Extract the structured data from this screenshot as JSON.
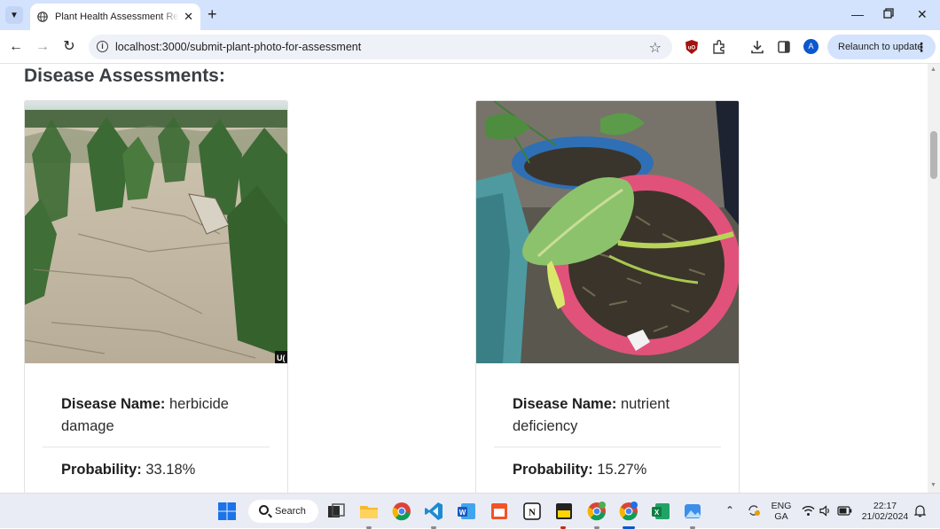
{
  "browser": {
    "tab_title": "Plant Health Assessment Results",
    "url": "localhost:3000/submit-plant-photo-for-assessment",
    "relaunch_label": "Relaunch to update",
    "profile_initial": "A"
  },
  "page": {
    "heading": "Disease Assessments:",
    "assessments": [
      {
        "name_label": "Disease Name:",
        "name_value": "herbicide damage",
        "prob_label": "Probability:",
        "prob_value": "33.18%",
        "image_badge": "U("
      },
      {
        "name_label": "Disease Name:",
        "name_value": "nutrient deficiency",
        "prob_label": "Probability:",
        "prob_value": "15.27%"
      }
    ]
  },
  "taskbar": {
    "search_label": "Search",
    "lang_primary": "ENG",
    "lang_secondary": "GA",
    "time": "22:17",
    "date": "21/02/2024"
  },
  "colors": {
    "tab_strip": "#d3e3fd",
    "heading": "#3a3f44",
    "accent": "#0b57d0"
  }
}
